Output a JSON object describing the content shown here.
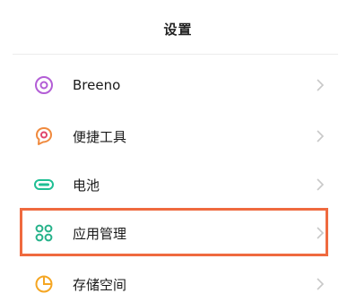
{
  "header": {
    "title": "设置"
  },
  "items": [
    {
      "label": "Breeno",
      "icon": "breeno-icon",
      "color": "#b35ed6"
    },
    {
      "label": "便捷工具",
      "icon": "shortcut-tools-icon",
      "color": "#f08a3e"
    },
    {
      "label": "电池",
      "icon": "battery-icon",
      "color": "#1fbf94"
    },
    {
      "label": "应用管理",
      "icon": "app-management-icon",
      "color": "#26b28a"
    },
    {
      "label": "存储空间",
      "icon": "storage-icon",
      "color": "#f5a623"
    }
  ],
  "highlight": {
    "target": "应用管理",
    "color": "#ef6a3f"
  },
  "chevron_color": "#c8c8c8"
}
